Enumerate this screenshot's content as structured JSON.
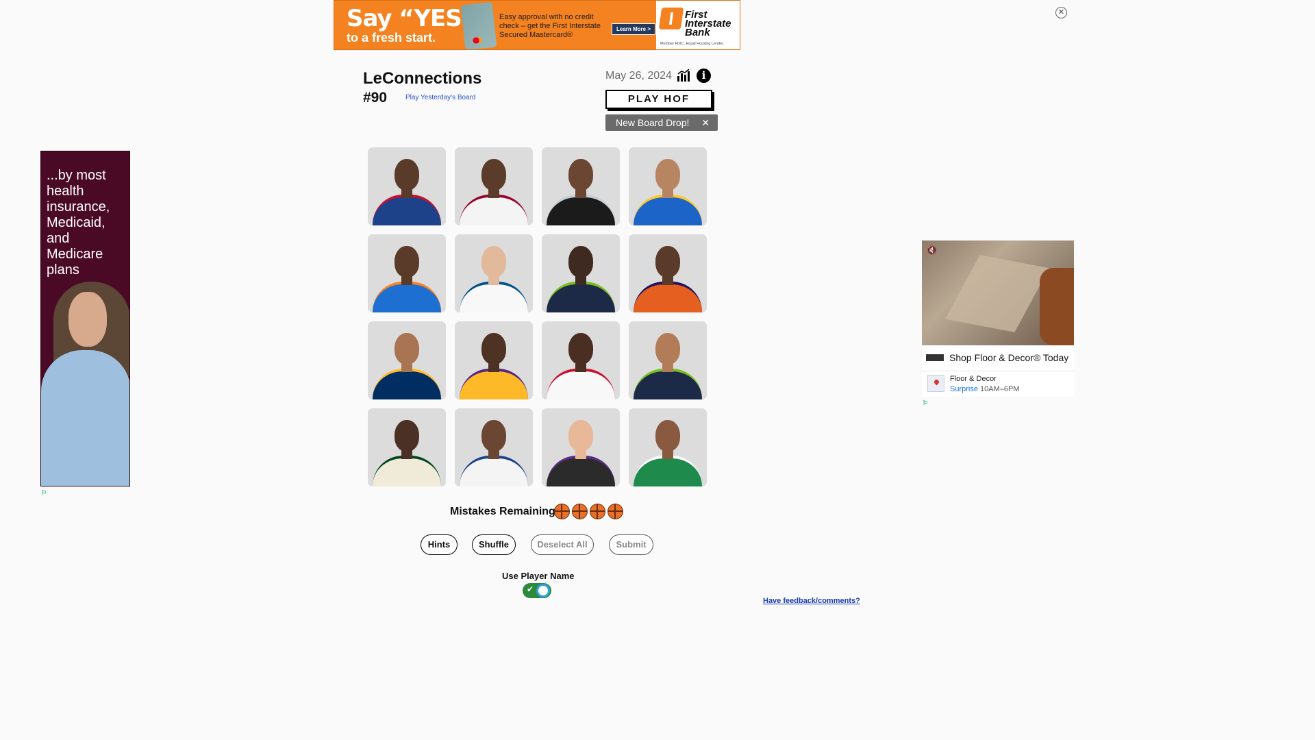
{
  "top_ad": {
    "headline": "Say “YES”",
    "subline": "to a fresh start.",
    "copy": "Easy approval with no credit check – get the First Interstate Secured Mastercard®",
    "cta": "Learn More >",
    "brand": "First Interstate Bank",
    "fine_print": "Member FDIC. Equal Housing Lender.",
    "colors": {
      "background": "#f58220",
      "cta": "#23395d"
    }
  },
  "header": {
    "title": "LeConnections",
    "board_number": "#90",
    "yesterday_link": "Play Yesterday's Board",
    "date": "May 26, 2024",
    "play_hof": "PLAY HOF",
    "new_board_tip": "New Board Drop!",
    "tip_close": "✕",
    "info_glyph": "i"
  },
  "grid": {
    "tiles": [
      {
        "icon": "player-headshot",
        "skin": "#5a3a28",
        "jersey": "#1d428a",
        "accent": "#c8102e"
      },
      {
        "icon": "player-headshot",
        "skin": "#5b3b2a",
        "jersey": "#f4f4f4",
        "accent": "#98002e"
      },
      {
        "icon": "player-headshot",
        "skin": "#6b4633",
        "jersey": "#1b1b1b",
        "accent": "#c4ced4"
      },
      {
        "icon": "player-headshot",
        "skin": "#b78561",
        "jersey": "#1d64c8",
        "accent": "#ffc72c"
      },
      {
        "icon": "player-headshot",
        "skin": "#5a3a28",
        "jersey": "#1d6fd1",
        "accent": "#f58426"
      },
      {
        "icon": "player-headshot",
        "skin": "#e3b99b",
        "jersey": "#f8f8f8",
        "accent": "#00538c"
      },
      {
        "icon": "player-headshot",
        "skin": "#3e2a20",
        "jersey": "#1c2a48",
        "accent": "#78be20"
      },
      {
        "icon": "player-headshot",
        "skin": "#5a3a28",
        "jersey": "#e56020",
        "accent": "#1d1160"
      },
      {
        "icon": "player-headshot",
        "skin": "#a87452",
        "jersey": "#002d62",
        "accent": "#fdbb30"
      },
      {
        "icon": "player-headshot",
        "skin": "#4e3224",
        "jersey": "#fdb927",
        "accent": "#552583"
      },
      {
        "icon": "player-headshot",
        "skin": "#4a2e22",
        "jersey": "#f8f8f8",
        "accent": "#c8102e"
      },
      {
        "icon": "player-headshot",
        "skin": "#b37c58",
        "jersey": "#1c2a48",
        "accent": "#78be20"
      },
      {
        "icon": "player-headshot",
        "skin": "#4b3025",
        "jersey": "#f0ebd8",
        "accent": "#00471b"
      },
      {
        "icon": "player-headshot",
        "skin": "#6b4633",
        "jersey": "#f4f4f4",
        "accent": "#1d428a"
      },
      {
        "icon": "player-headshot",
        "skin": "#e8b898",
        "jersey": "#2b2b2b",
        "accent": "#5a2d81"
      },
      {
        "icon": "player-headshot",
        "skin": "#8a5a40",
        "jersey": "#1e8a4c",
        "accent": "#ffffff"
      }
    ]
  },
  "mistakes": {
    "label": "Mistakes Remaining:",
    "remaining": 4,
    "icon": "basketball-icon"
  },
  "controls": {
    "hints": "Hints",
    "shuffle": "Shuffle",
    "deselect_all": "Deselect All",
    "submit": "Submit"
  },
  "toggle": {
    "label": "Use Player Name",
    "checked": true
  },
  "feedback": "Have feedback/comments?",
  "left_ad": {
    "text": "...by most health insurance, Medicaid, and Medicare plans",
    "background": "#4a0a26"
  },
  "right_ad": {
    "headline": "Shop Floor & Decor® Today",
    "store": "Floor & Decor",
    "city": "Surprise",
    "hours": "10AM–6PM"
  }
}
